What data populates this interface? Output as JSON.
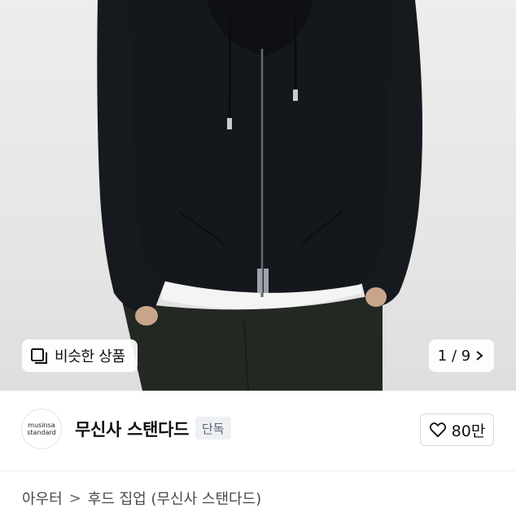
{
  "gallery": {
    "similar_label": "비슷한 상품",
    "similar_icon": "similar-items-icon",
    "pager_text": "1 / 9",
    "pager_icon": "chevron-right-icon"
  },
  "brand": {
    "logo_line1": "musinsa",
    "logo_line2": "standard",
    "name": "무신사 스탠다드",
    "badge": "단독",
    "like_icon": "heart-outline-icon",
    "like_count": "80만"
  },
  "breadcrumb": {
    "items": [
      "아우터",
      "후드 집업 (무신사 스탠다드)"
    ],
    "separator": ">"
  },
  "colors": {
    "background": "#ffffff",
    "badge_bg": "#eef0f3",
    "badge_text": "#5a6270",
    "garment": "#14171c"
  }
}
